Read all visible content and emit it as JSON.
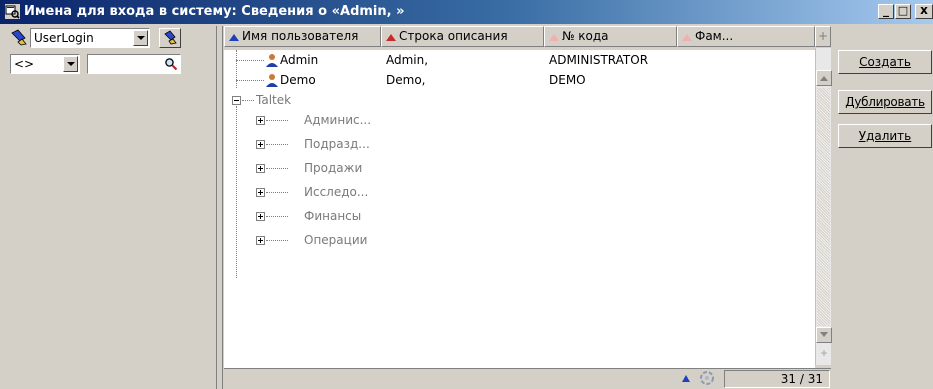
{
  "window": {
    "title": "Имена для входа в систему: Сведения о «Admin, »",
    "minimize": "_",
    "maximize": "□",
    "close": "x"
  },
  "filter": {
    "field_value": "UserLogin",
    "operator_value": "<>",
    "value_input": ""
  },
  "grid": {
    "columns": [
      "Имя пользователя",
      "Строка описания",
      "№ кода",
      "Фам..."
    ],
    "rows": [
      {
        "name": "Admin",
        "description": "Admin,",
        "code": "ADMINISTRATOR"
      },
      {
        "name": "Demo",
        "description": "Demo,",
        "code": "DEMO"
      }
    ],
    "tree": {
      "root": "Taltek",
      "children": [
        "Админис...",
        "Подразд...",
        "Продажи",
        "Исследо...",
        "Финансы",
        "Операции"
      ]
    }
  },
  "status": {
    "count": "31 / 31"
  },
  "buttons": {
    "create": "Создать",
    "duplicate": "Дублировать",
    "delete": "Удалить"
  },
  "colors": {
    "title_start": "#0a246a",
    "title_end": "#a6caf0",
    "sort_active": "#1f3fbf",
    "sort_inactive": "#cc2a2a"
  }
}
